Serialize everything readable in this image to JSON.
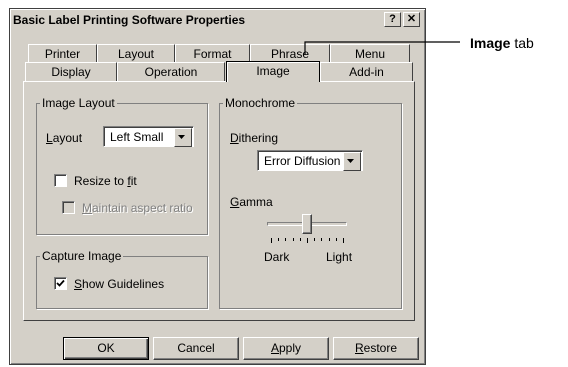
{
  "window": {
    "title": "Basic Label Printing Software Properties",
    "help_label": "?",
    "close_label": "✕"
  },
  "tabs_row1": [
    "Printer",
    "Layout",
    "Format",
    "Phrase",
    "Menu"
  ],
  "tabs_row2": [
    "Display",
    "Operation",
    "Image",
    "Add-in"
  ],
  "active_tab": "Image",
  "image_layout": {
    "title": "Image Layout",
    "layout_label": "Layout",
    "layout_value": "Left Small",
    "resize_label": "Resize to fit",
    "resize_checked": false,
    "aspect_label": "Maintain aspect ratio",
    "aspect_checked": false,
    "aspect_enabled": false
  },
  "capture_image": {
    "title": "Capture Image",
    "guidelines_label": "Show Guidelines",
    "guidelines_checked": true
  },
  "monochrome": {
    "title": "Monochrome",
    "dithering_label": "Dithering",
    "dithering_value": "Error Diffusion",
    "gamma_label": "Gamma",
    "gamma_level": 0.5,
    "dark_label": "Dark",
    "light_label": "Light"
  },
  "buttons": {
    "ok": "OK",
    "cancel": "Cancel",
    "apply": "Apply",
    "restore": "Restore"
  },
  "callout": {
    "bold": "Image",
    "rest": " tab"
  }
}
